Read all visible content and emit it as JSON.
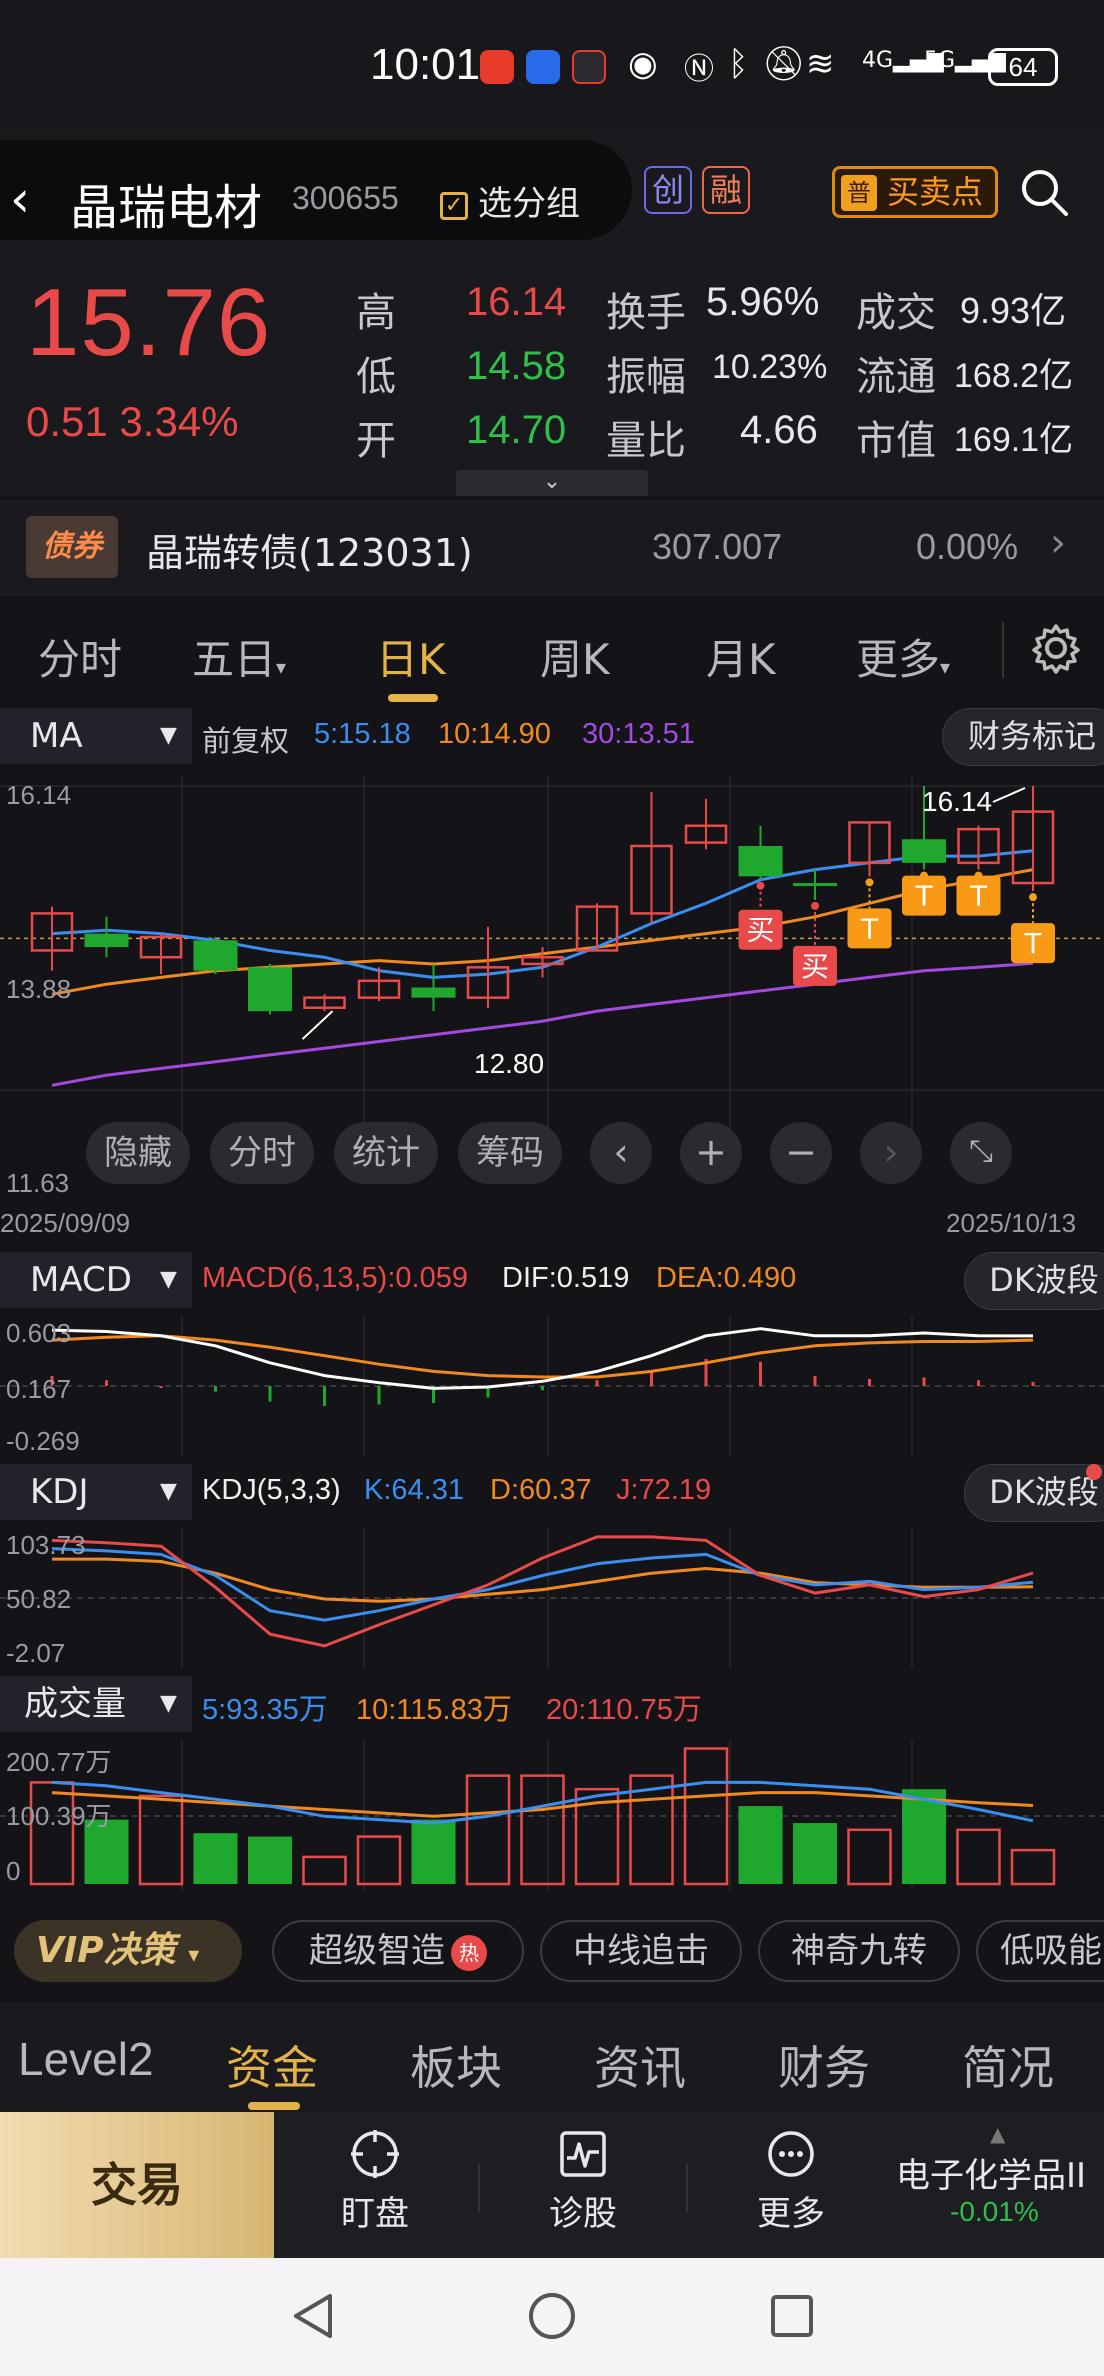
{
  "status_bar": {
    "time": "10:01",
    "battery": "64",
    "network_1": "4G",
    "network_2": "5G"
  },
  "header": {
    "stock_name": "晶瑞电材",
    "stock_code": "300655",
    "group_label": "选分组",
    "tag_chuang": "创",
    "tag_rong": "融",
    "buysell_badge": "普",
    "buysell_label": "买卖点"
  },
  "quote": {
    "price": "15.76",
    "change": "0.51",
    "change_pct": "3.34%",
    "high_label": "高",
    "high": "16.14",
    "low_label": "低",
    "low": "14.58",
    "open_label": "开",
    "open": "14.70",
    "turnover_label": "换手",
    "turnover": "5.96%",
    "amplitude_label": "振幅",
    "amplitude": "10.23%",
    "volume_ratio_label": "量比",
    "volume_ratio": "4.66",
    "deal_label": "成交",
    "deal": "9.93亿",
    "float_label": "流通",
    "float": "168.2亿",
    "mktcap_label": "市值",
    "mktcap": "169.1亿"
  },
  "bond": {
    "badge": "债券",
    "name": "晶瑞转债(123031)",
    "price": "307.007",
    "pct": "0.00%"
  },
  "kline_tabs": [
    "分时",
    "五日",
    "日K",
    "周K",
    "月K",
    "更多"
  ],
  "kline_active": "日K",
  "main_chart": {
    "indicator": "MA",
    "adjust": "前复权",
    "ma5": "5:15.18",
    "ma10": "10:14.90",
    "ma30": "30:13.51",
    "finance_btn": "财务标记",
    "y_top": "16.14",
    "y_mid": "13.88",
    "y_bottom": "11.63",
    "date_start": "2025/09/09",
    "date_end": "2025/10/13",
    "high_marker": "16.14",
    "low_marker": "12.80",
    "tools": [
      "隐藏",
      "分时",
      "统计",
      "筹码"
    ],
    "signals": {
      "buy": "买",
      "t": "T"
    }
  },
  "macd": {
    "indicator": "MACD",
    "macd": "MACD(6,13,5):0.059",
    "dif": "DIF:0.519",
    "dea": "DEA:0.490",
    "btn": "DK波段",
    "y_top": "0.603",
    "y_mid": "0.167",
    "y_bottom": "-0.269"
  },
  "kdj": {
    "indicator": "KDJ",
    "params": "KDJ(5,3,3)",
    "k": "K:64.31",
    "d": "D:60.37",
    "j": "J:72.19",
    "btn": "DK波段",
    "y_top": "103.73",
    "y_mid": "50.82",
    "y_bottom": "-2.07"
  },
  "volume": {
    "indicator": "成交量",
    "v5": "5:93.35万",
    "v10": "10:115.83万",
    "v20": "20:110.75万",
    "y_top": "200.77万",
    "y_mid": "100.39万",
    "y_bottom": "0"
  },
  "chart_data": {
    "type": "candlestick",
    "x_range": [
      "2025/09/09",
      "2025/10/13"
    ],
    "candles": [
      {
        "o": 13.7,
        "c": 14.25,
        "h": 14.35,
        "l": 13.4,
        "up": true
      },
      {
        "o": 13.95,
        "c": 13.75,
        "h": 14.2,
        "l": 13.6,
        "up": false
      },
      {
        "o": 13.6,
        "c": 13.9,
        "h": 13.95,
        "l": 13.35,
        "up": true
      },
      {
        "o": 13.85,
        "c": 13.4,
        "h": 13.9,
        "l": 13.35,
        "up": false
      },
      {
        "o": 13.45,
        "c": 12.8,
        "h": 13.5,
        "l": 12.75,
        "up": false
      },
      {
        "o": 12.85,
        "c": 13.0,
        "h": 13.05,
        "l": 12.8,
        "up": true
      },
      {
        "o": 13.0,
        "c": 13.25,
        "h": 13.45,
        "l": 12.95,
        "up": true
      },
      {
        "o": 13.15,
        "c": 13.0,
        "h": 13.5,
        "l": 12.8,
        "up": false
      },
      {
        "o": 13.0,
        "c": 13.45,
        "h": 14.05,
        "l": 12.85,
        "up": true
      },
      {
        "o": 13.5,
        "c": 13.6,
        "h": 13.75,
        "l": 13.3,
        "up": true
      },
      {
        "o": 13.7,
        "c": 14.35,
        "h": 14.4,
        "l": 13.7,
        "up": true
      },
      {
        "o": 14.25,
        "c": 15.25,
        "h": 16.05,
        "l": 14.1,
        "up": true
      },
      {
        "o": 15.3,
        "c": 15.55,
        "h": 15.95,
        "l": 15.2,
        "up": true
      },
      {
        "o": 15.25,
        "c": 14.8,
        "h": 15.55,
        "l": 14.75,
        "up": false
      },
      {
        "o": 14.7,
        "c": 14.7,
        "h": 14.9,
        "l": 14.45,
        "up": false
      },
      {
        "o": 15.0,
        "c": 15.6,
        "h": 15.6,
        "l": 14.8,
        "up": true
      },
      {
        "o": 15.35,
        "c": 15.0,
        "h": 16.14,
        "l": 14.9,
        "up": false
      },
      {
        "o": 15.0,
        "c": 15.5,
        "h": 15.55,
        "l": 14.9,
        "up": true
      },
      {
        "o": 14.7,
        "c": 15.76,
        "h": 16.14,
        "l": 14.58,
        "up": true
      }
    ],
    "ma5": [
      13.95,
      14.0,
      13.95,
      13.85,
      13.7,
      13.6,
      13.4,
      13.3,
      13.35,
      13.45,
      13.75,
      14.1,
      14.4,
      14.75,
      14.9,
      15.0,
      15.1,
      15.1,
      15.18
    ],
    "ma10": [
      13.05,
      13.2,
      13.3,
      13.4,
      13.45,
      13.5,
      13.55,
      13.5,
      13.55,
      13.65,
      13.75,
      13.85,
      13.95,
      14.05,
      14.2,
      14.4,
      14.6,
      14.75,
      14.9
    ],
    "ma30": [
      11.7,
      11.85,
      11.95,
      12.05,
      12.15,
      12.25,
      12.35,
      12.45,
      12.55,
      12.65,
      12.8,
      12.9,
      13.0,
      13.1,
      13.2,
      13.3,
      13.4,
      13.45,
      13.51
    ],
    "price_range": [
      11.63,
      16.14
    ],
    "macd_dif": [
      0.56,
      0.55,
      0.52,
      0.45,
      0.33,
      0.24,
      0.19,
      0.15,
      0.16,
      0.2,
      0.27,
      0.38,
      0.52,
      0.57,
      0.52,
      0.52,
      0.54,
      0.52,
      0.519
    ],
    "macd_dea": [
      0.49,
      0.51,
      0.52,
      0.49,
      0.44,
      0.38,
      0.32,
      0.27,
      0.24,
      0.23,
      0.23,
      0.27,
      0.33,
      0.4,
      0.45,
      0.47,
      0.48,
      0.48,
      0.49
    ],
    "macd_range": [
      -0.269,
      0.603
    ],
    "kdj_k": [
      93,
      91,
      88,
      70,
      40,
      32,
      40,
      50,
      58,
      70,
      80,
      85,
      88,
      70,
      62,
      65,
      58,
      60,
      64.31
    ],
    "kdj_d": [
      84,
      84,
      82,
      72,
      58,
      50,
      48,
      50,
      54,
      58,
      65,
      72,
      76,
      72,
      64,
      62,
      60,
      60,
      60.37
    ],
    "kdj_j": [
      100,
      98,
      95,
      60,
      20,
      10,
      28,
      45,
      62,
      85,
      103,
      103,
      100,
      70,
      55,
      62,
      52,
      58,
      72.19
    ],
    "kdj_range": [
      -2.07,
      103.73
    ],
    "volume": [
      150,
      95,
      130,
      75,
      70,
      40,
      70,
      95,
      160,
      160,
      140,
      160,
      200,
      115,
      90,
      80,
      140,
      80,
      50
    ],
    "vol_ma5": [
      150,
      145,
      135,
      125,
      115,
      100,
      95,
      90,
      100,
      115,
      130,
      140,
      150,
      150,
      145,
      140,
      125,
      110,
      93.35
    ],
    "vol_ma10": [
      135,
      130,
      125,
      120,
      115,
      110,
      105,
      100,
      105,
      110,
      120,
      125,
      130,
      135,
      135,
      130,
      125,
      120,
      115.83
    ],
    "volume_range": [
      0,
      200.77
    ],
    "signals": [
      {
        "index": 13,
        "label": "买"
      },
      {
        "index": 14,
        "label": "买"
      },
      {
        "index": 15,
        "label": "T"
      },
      {
        "index": 16,
        "label": "T"
      },
      {
        "index": 17,
        "label": "T"
      },
      {
        "index": 18,
        "label": "T"
      }
    ]
  },
  "vip": {
    "label": "VIP决策",
    "features": [
      "超级智造",
      "中线追击",
      "神奇九转",
      "低吸能"
    ],
    "hot": "热"
  },
  "bottom_tabs": [
    "Level2",
    "资金",
    "板块",
    "资讯",
    "财务",
    "简况"
  ],
  "bottom_active": "资金",
  "actions": {
    "trade": "交易",
    "watch": "盯盘",
    "diagnose": "诊股",
    "more": "更多",
    "sector_name": "电子化学品II",
    "sector_pct": "-0.01%"
  },
  "colors": {
    "up": "#e84a4a",
    "down": "#1fa82e",
    "accent": "#e3b34a",
    "ma5": "#3a8ef0",
    "ma10": "#f08a20",
    "ma30": "#a34ae0"
  }
}
